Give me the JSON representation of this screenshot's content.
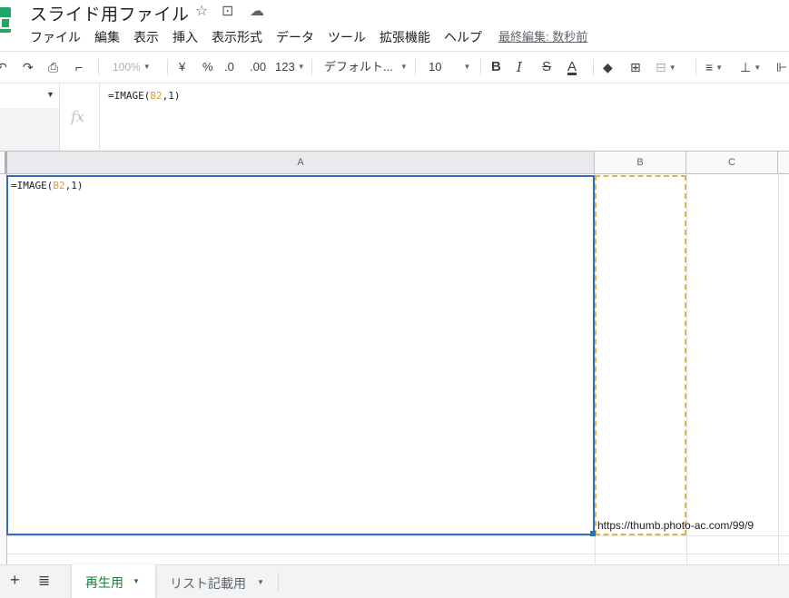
{
  "header": {
    "title": "スライド用ファイル",
    "last_edit": "最終編集: 数秒前",
    "menu": [
      "ファイル",
      "編集",
      "表示",
      "挿入",
      "表示形式",
      "データ",
      "ツール",
      "拡張機能",
      "ヘルプ"
    ]
  },
  "toolbar": {
    "zoom": "100%",
    "currency": "¥",
    "percent": "%",
    "decrease_decimal": ".0",
    "increase_decimal": ".00",
    "number_format": "123",
    "font": "デフォルト...",
    "font_size": "10",
    "bold": "B",
    "italic": "I",
    "strikethrough": "S",
    "text_color": "A"
  },
  "formula_bar": {
    "prefix": "=IMAGE(",
    "ref": "B2",
    "suffix": ",1)"
  },
  "columns": [
    "A",
    "B",
    "C"
  ],
  "cells": {
    "a1_prefix": "=IMAGE(",
    "a1_ref": "B2",
    "a1_suffix": ",1)",
    "b_url": "https://thumb.photo-ac.com/99/9"
  },
  "sheets": {
    "active": "再生用",
    "second": "リスト記載用"
  },
  "colors": {
    "brand_green": "#23a566",
    "selection_blue": "#2e6fb7",
    "reference_gold": "#e6b04a",
    "active_tab_green": "#188038"
  }
}
